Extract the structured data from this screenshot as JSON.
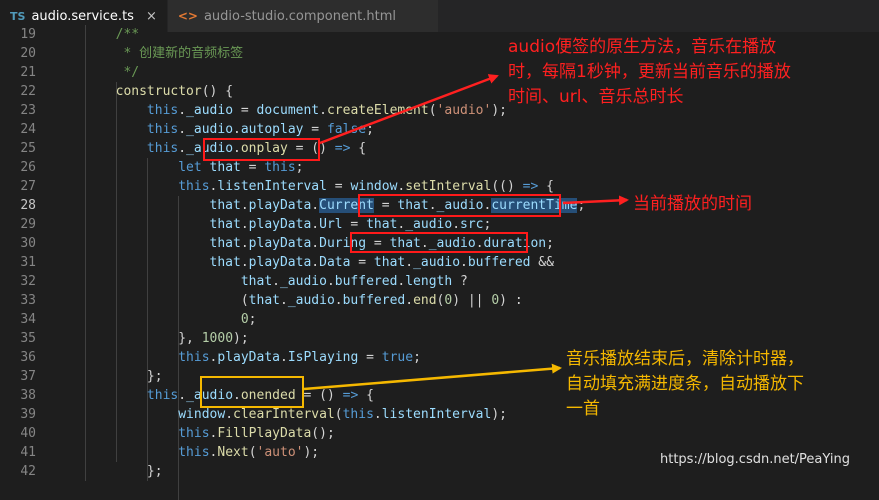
{
  "tabs": [
    {
      "icon": "TS",
      "label": "audio.service.ts",
      "close": "×",
      "active": true
    },
    {
      "icon": "<>",
      "label": "audio-studio.component.html",
      "active": false
    }
  ],
  "lines": [
    {
      "n": "19",
      "tokens": [
        [
          "cmt",
          "        /**"
        ]
      ]
    },
    {
      "n": "20",
      "tokens": [
        [
          "cmt",
          "         * 创建新的音频标签"
        ]
      ]
    },
    {
      "n": "21",
      "tokens": [
        [
          "cmt",
          "         */"
        ]
      ]
    },
    {
      "n": "22",
      "tokens": [
        [
          "fn",
          "        constructor"
        ],
        [
          "pl",
          "() {"
        ]
      ]
    },
    {
      "n": "23",
      "tokens": [
        [
          "kw",
          "            this"
        ],
        [
          "pl",
          "."
        ],
        [
          "pr",
          "_audio"
        ],
        [
          "pl",
          " = "
        ],
        [
          "pr",
          "document"
        ],
        [
          "pl",
          "."
        ],
        [
          "fn",
          "createElement"
        ],
        [
          "pl",
          "("
        ],
        [
          "str",
          "'audio'"
        ],
        [
          "pl",
          ");"
        ]
      ]
    },
    {
      "n": "24",
      "tokens": [
        [
          "kw",
          "            this"
        ],
        [
          "pl",
          "."
        ],
        [
          "pr",
          "_audio"
        ],
        [
          "pl",
          "."
        ],
        [
          "pr",
          "autoplay"
        ],
        [
          "pl",
          " = "
        ],
        [
          "kw",
          "false"
        ],
        [
          "pl",
          ";"
        ]
      ]
    },
    {
      "n": "25",
      "tokens": [
        [
          "kw",
          "            this"
        ],
        [
          "pl",
          "."
        ],
        [
          "pr",
          "_audio"
        ],
        [
          "pl",
          "."
        ],
        [
          "fn",
          "onplay"
        ],
        [
          "pl",
          " = () "
        ],
        [
          "kw",
          "=>"
        ],
        [
          "pl",
          " {"
        ]
      ]
    },
    {
      "n": "26",
      "tokens": [
        [
          "kw",
          "                let"
        ],
        [
          "pr",
          " that"
        ],
        [
          "pl",
          " = "
        ],
        [
          "kw",
          "this"
        ],
        [
          "pl",
          ";"
        ]
      ]
    },
    {
      "n": "27",
      "tokens": [
        [
          "kw",
          "                this"
        ],
        [
          "pl",
          "."
        ],
        [
          "pr",
          "listenInterval"
        ],
        [
          "pl",
          " = "
        ],
        [
          "pr",
          "window"
        ],
        [
          "pl",
          "."
        ],
        [
          "fn",
          "setInterval"
        ],
        [
          "pl",
          "(() "
        ],
        [
          "kw",
          "=>"
        ],
        [
          "pl",
          " {"
        ]
      ]
    },
    {
      "n": "28",
      "current": true,
      "tokens": [
        [
          "pr",
          "                    that"
        ],
        [
          "pl",
          "."
        ],
        [
          "pr",
          "playData"
        ],
        [
          "pl",
          "."
        ],
        [
          "hl",
          "Current"
        ],
        [
          "pl",
          " = "
        ],
        [
          "pr",
          "that"
        ],
        [
          "pl",
          "."
        ],
        [
          "pr",
          "_audio"
        ],
        [
          "pl",
          "."
        ],
        [
          "hl",
          "currentTime"
        ],
        [
          "pl",
          ";"
        ]
      ]
    },
    {
      "n": "29",
      "tokens": [
        [
          "pr",
          "                    that"
        ],
        [
          "pl",
          "."
        ],
        [
          "pr",
          "playData"
        ],
        [
          "pl",
          "."
        ],
        [
          "pr",
          "Url"
        ],
        [
          "pl",
          " = "
        ],
        [
          "pr",
          "that"
        ],
        [
          "pl",
          "."
        ],
        [
          "pr",
          "_audio"
        ],
        [
          "pl",
          "."
        ],
        [
          "pr",
          "src"
        ],
        [
          "pl",
          ";"
        ]
      ]
    },
    {
      "n": "30",
      "tokens": [
        [
          "pr",
          "                    that"
        ],
        [
          "pl",
          "."
        ],
        [
          "pr",
          "playData"
        ],
        [
          "pl",
          "."
        ],
        [
          "pr",
          "During"
        ],
        [
          "pl",
          " = "
        ],
        [
          "pr",
          "that"
        ],
        [
          "pl",
          "."
        ],
        [
          "pr",
          "_audio"
        ],
        [
          "pl",
          "."
        ],
        [
          "pr",
          "duration"
        ],
        [
          "pl",
          ";"
        ]
      ]
    },
    {
      "n": "31",
      "tokens": [
        [
          "pr",
          "                    that"
        ],
        [
          "pl",
          "."
        ],
        [
          "pr",
          "playData"
        ],
        [
          "pl",
          "."
        ],
        [
          "pr",
          "Data"
        ],
        [
          "pl",
          " = "
        ],
        [
          "pr",
          "that"
        ],
        [
          "pl",
          "."
        ],
        [
          "pr",
          "_audio"
        ],
        [
          "pl",
          "."
        ],
        [
          "pr",
          "buffered"
        ],
        [
          "pl",
          " &&"
        ]
      ]
    },
    {
      "n": "32",
      "tokens": [
        [
          "pr",
          "                        that"
        ],
        [
          "pl",
          "."
        ],
        [
          "pr",
          "_audio"
        ],
        [
          "pl",
          "."
        ],
        [
          "pr",
          "buffered"
        ],
        [
          "pl",
          "."
        ],
        [
          "pr",
          "length"
        ],
        [
          "pl",
          " ?"
        ]
      ]
    },
    {
      "n": "33",
      "tokens": [
        [
          "pl",
          "                        ("
        ],
        [
          "pr",
          "that"
        ],
        [
          "pl",
          "."
        ],
        [
          "pr",
          "_audio"
        ],
        [
          "pl",
          "."
        ],
        [
          "pr",
          "buffered"
        ],
        [
          "pl",
          "."
        ],
        [
          "fn",
          "end"
        ],
        [
          "pl",
          "("
        ],
        [
          "num",
          "0"
        ],
        [
          "pl",
          ") || "
        ],
        [
          "num",
          "0"
        ],
        [
          "pl",
          ") :"
        ]
      ]
    },
    {
      "n": "34",
      "tokens": [
        [
          "num",
          "                        0"
        ],
        [
          "pl",
          ";"
        ]
      ]
    },
    {
      "n": "35",
      "tokens": [
        [
          "pl",
          "                }, "
        ],
        [
          "num",
          "1000"
        ],
        [
          "pl",
          ");"
        ]
      ]
    },
    {
      "n": "36",
      "tokens": [
        [
          "kw",
          "                this"
        ],
        [
          "pl",
          "."
        ],
        [
          "pr",
          "playData"
        ],
        [
          "pl",
          "."
        ],
        [
          "pr",
          "IsPlaying"
        ],
        [
          "pl",
          " = "
        ],
        [
          "kw",
          "true"
        ],
        [
          "pl",
          ";"
        ]
      ]
    },
    {
      "n": "37",
      "tokens": [
        [
          "pl",
          "            };"
        ]
      ]
    },
    {
      "n": "38",
      "tokens": [
        [
          "kw",
          "            this"
        ],
        [
          "pl",
          "."
        ],
        [
          "pr",
          "_audio"
        ],
        [
          "pl",
          "."
        ],
        [
          "fn",
          "onended"
        ],
        [
          "pl",
          " = () "
        ],
        [
          "kw",
          "=>"
        ],
        [
          "pl",
          " {"
        ]
      ]
    },
    {
      "n": "39",
      "tokens": [
        [
          "pr",
          "                window"
        ],
        [
          "pl",
          "."
        ],
        [
          "fn",
          "clearInterval"
        ],
        [
          "pl",
          "("
        ],
        [
          "kw",
          "this"
        ],
        [
          "pl",
          "."
        ],
        [
          "pr",
          "listenInterval"
        ],
        [
          "pl",
          ");"
        ]
      ]
    },
    {
      "n": "40",
      "tokens": [
        [
          "kw",
          "                this"
        ],
        [
          "pl",
          "."
        ],
        [
          "fn",
          "FillPlayData"
        ],
        [
          "pl",
          "();"
        ]
      ]
    },
    {
      "n": "41",
      "tokens": [
        [
          "kw",
          "                this"
        ],
        [
          "pl",
          "."
        ],
        [
          "fn",
          "Next"
        ],
        [
          "pl",
          "("
        ],
        [
          "str",
          "'auto'"
        ],
        [
          "pl",
          ");"
        ]
      ]
    },
    {
      "n": "42",
      "tokens": [
        [
          "pl",
          "            };"
        ]
      ]
    }
  ],
  "annotations": {
    "note1": [
      "audio便签的原生方法，音乐在播放",
      "时，每隔1秒钟，更新当前音乐的播放",
      "时间、url、音乐总时长"
    ],
    "note2": "当前播放的时间",
    "note3": [
      "音乐播放结束后，清除计时器，",
      "自动填充满进度条，自动播放下",
      "一首"
    ]
  },
  "watermark": "https://blog.csdn.net/PeaYing",
  "colors": {
    "red": "#ff2020",
    "orange": "#f5b800",
    "background": "#1e1e1e"
  }
}
